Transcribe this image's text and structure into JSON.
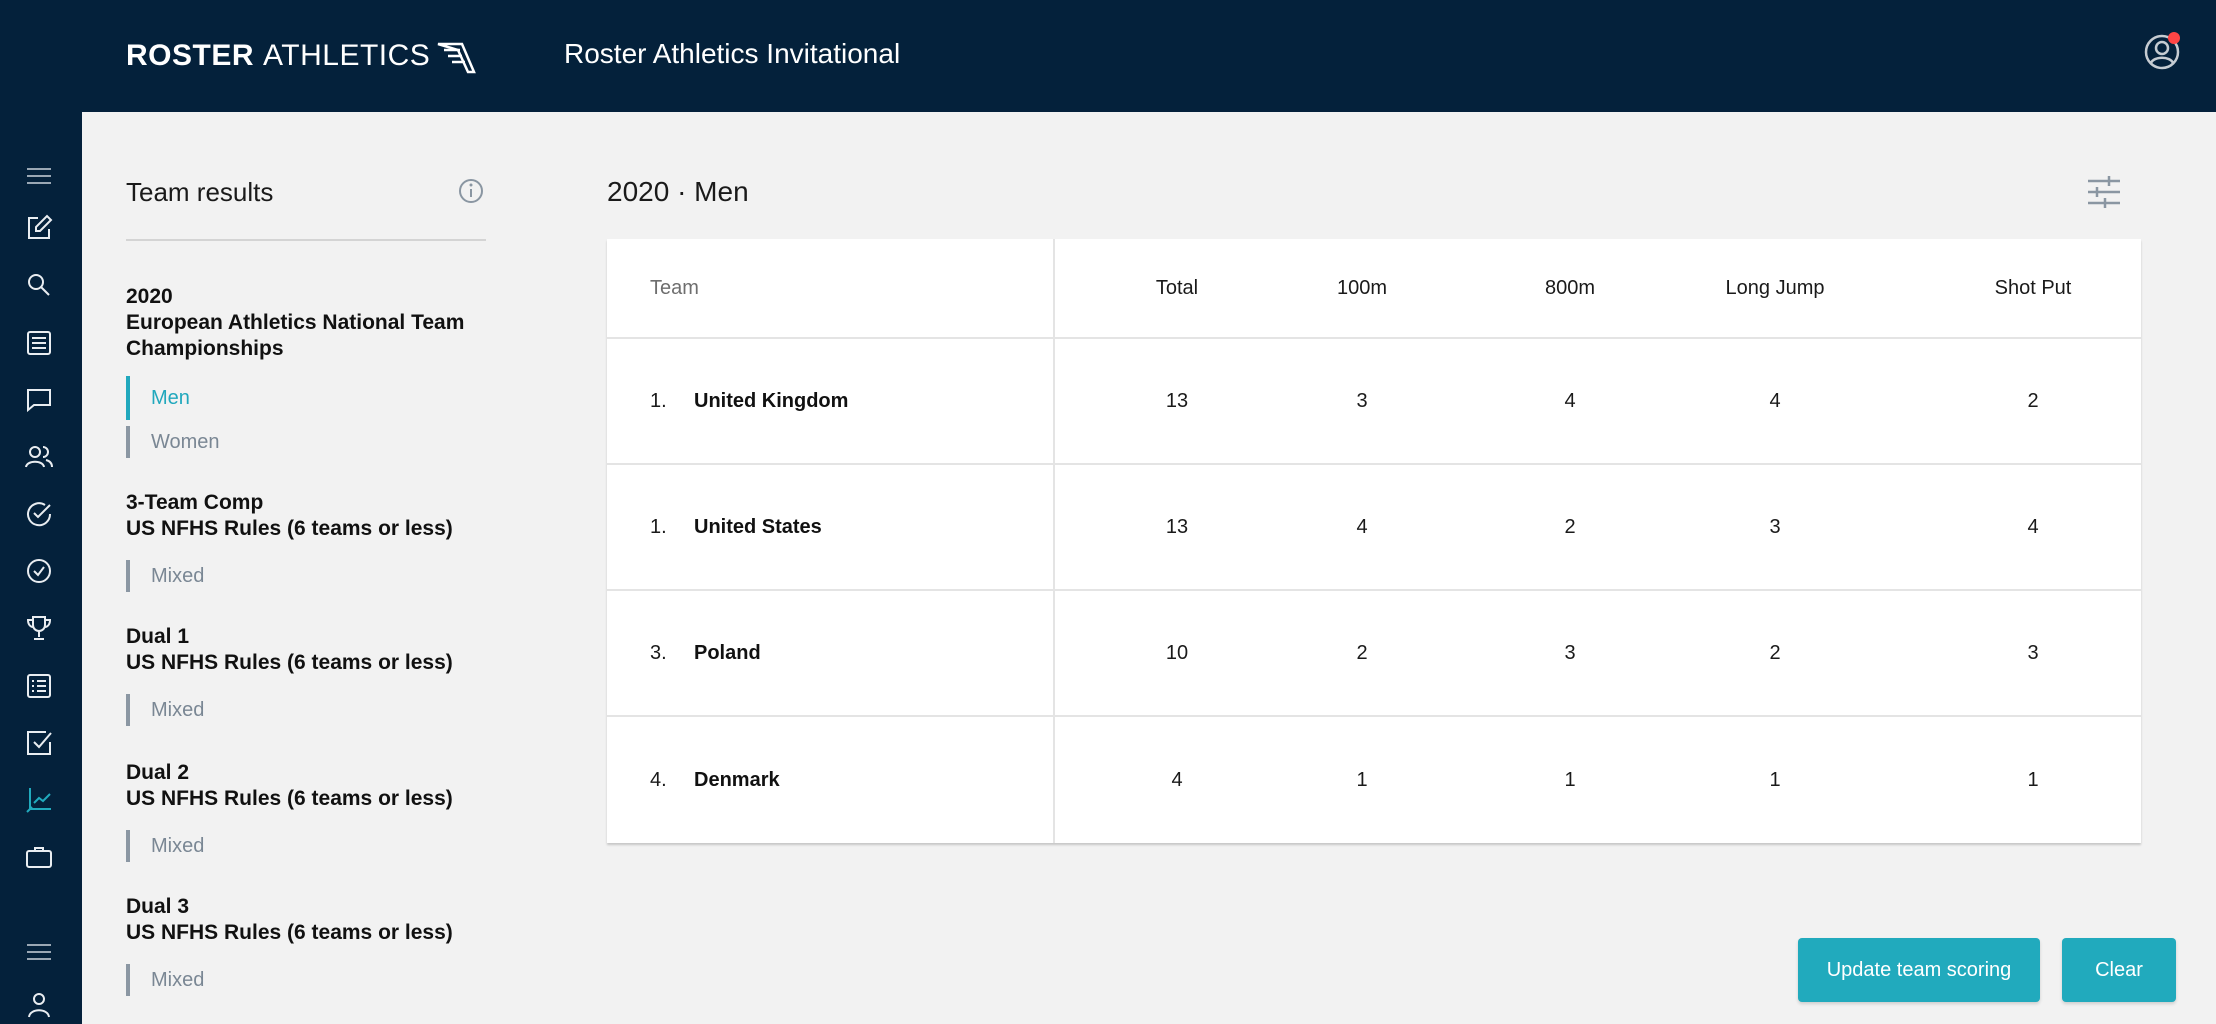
{
  "header": {
    "logo_bold": "ROSTER",
    "logo_light": "ATHLETICS",
    "title": "Roster Athletics Invitational"
  },
  "rail": {
    "icons": [
      "menu-icon",
      "edit-icon",
      "search-icon",
      "document-icon",
      "chat-icon",
      "people-icon",
      "check-circle-icon",
      "check-circle-icon",
      "trophy-icon",
      "list-icon",
      "checkbox-icon",
      "results-icon",
      "briefcase-icon",
      "menu-icon",
      "user-icon"
    ],
    "active_index": 11
  },
  "panel": {
    "title": "Team results",
    "groups": [
      {
        "title_lines": [
          "2020",
          "European Athletics National Team",
          "Championships"
        ],
        "items": [
          {
            "label": "Men",
            "active": true
          },
          {
            "label": "Women",
            "active": false
          }
        ]
      },
      {
        "title_lines": [
          "3-Team Comp",
          "US NFHS Rules (6 teams or less)"
        ],
        "items": [
          {
            "label": "Mixed",
            "active": false
          }
        ]
      },
      {
        "title_lines": [
          "Dual 1",
          "US NFHS Rules (6 teams or less)"
        ],
        "items": [
          {
            "label": "Mixed",
            "active": false
          }
        ]
      },
      {
        "title_lines": [
          "Dual 2",
          "US NFHS Rules (6 teams or less)"
        ],
        "items": [
          {
            "label": "Mixed",
            "active": false
          }
        ]
      },
      {
        "title_lines": [
          "Dual 3",
          "US NFHS Rules (6 teams or less)"
        ],
        "items": [
          {
            "label": "Mixed",
            "active": false
          }
        ]
      }
    ]
  },
  "main": {
    "title": "2020 · Men",
    "table": {
      "headers": {
        "team": "Team",
        "total": "Total",
        "events": [
          "100m",
          "800m",
          "Long Jump",
          "Shot Put"
        ]
      },
      "rows": [
        {
          "rank": "1.",
          "team": "United Kingdom",
          "total": "13",
          "scores": [
            "3",
            "4",
            "4",
            "2"
          ]
        },
        {
          "rank": "1.",
          "team": "United States",
          "total": "13",
          "scores": [
            "4",
            "2",
            "3",
            "4"
          ]
        },
        {
          "rank": "3.",
          "team": "Poland",
          "total": "10",
          "scores": [
            "2",
            "3",
            "2",
            "3"
          ]
        },
        {
          "rank": "4.",
          "team": "Denmark",
          "total": "4",
          "scores": [
            "1",
            "1",
            "1",
            "1"
          ]
        }
      ]
    }
  },
  "actions": {
    "update_label": "Update team scoring",
    "clear_label": "Clear"
  },
  "colors": {
    "navy": "#04213b",
    "accent": "#21aabd",
    "notification": "#ff4545"
  }
}
